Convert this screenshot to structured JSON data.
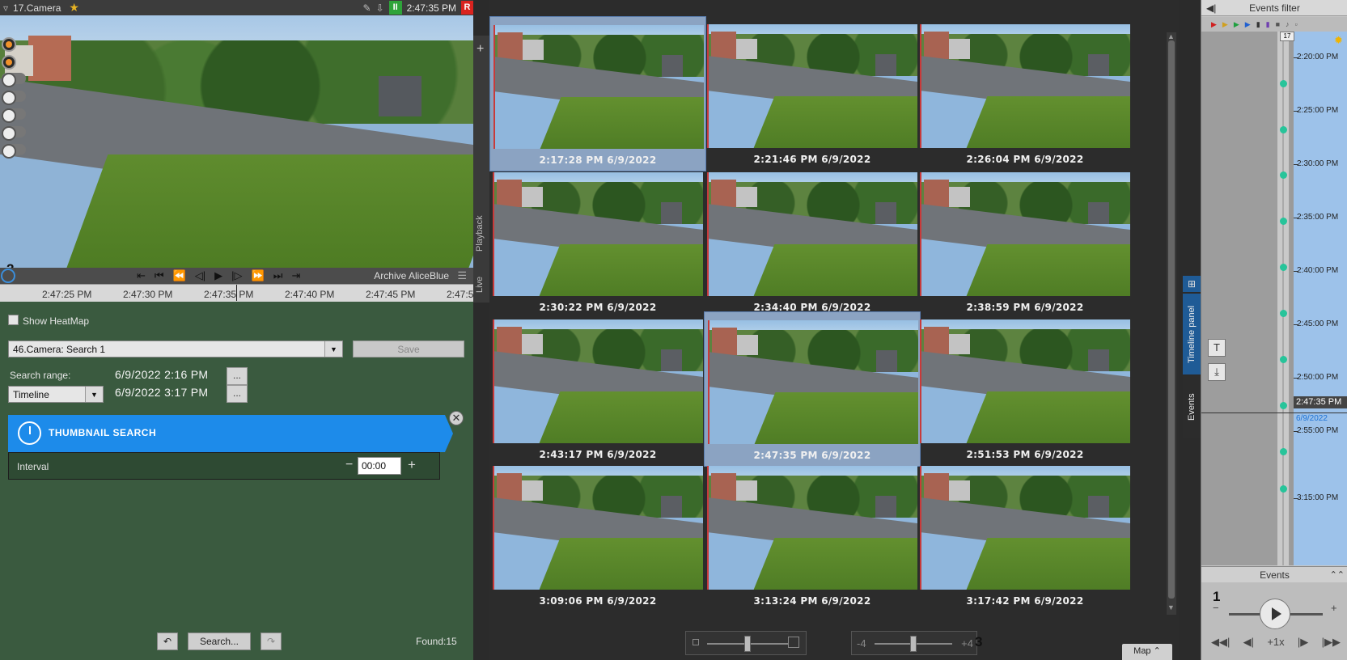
{
  "camera": {
    "title": "17.Camera",
    "time": "2:47:35 PM",
    "pause_glyph": "II",
    "rec_glyph": "R",
    "number_badge": "2",
    "archive_label": "Archive AliceBlue",
    "timescale_ticks": [
      "2:47:25 PM",
      "2:47:30 PM",
      "2:47:35 PM",
      "2:47:40 PM",
      "2:47:45 PM",
      "2:47:5"
    ]
  },
  "side_tabs": {
    "plus": "+",
    "playback": "Playback",
    "live": "Live"
  },
  "search": {
    "heatmap_label": "Show HeatMap",
    "search_name": "46.Camera: Search 1",
    "save_label": "Save",
    "range_label": "Search range:",
    "range_start": "6/9/2022  2:16 PM",
    "range_end": "6/9/2022  3:17 PM",
    "range_mode": "Timeline",
    "dots": "...",
    "thumb_title": "THUMBNAIL SEARCH",
    "interval_label": "Interval",
    "interval_value": "00:00",
    "search_button": "Search...",
    "found": "Found:15"
  },
  "grid": {
    "thumbnails": [
      {
        "caption": "2:17:28 PM 6/9/2022",
        "selected": true
      },
      {
        "caption": "2:21:46 PM 6/9/2022",
        "selected": false
      },
      {
        "caption": "2:26:04 PM 6/9/2022",
        "selected": false
      },
      {
        "caption": "2:30:22 PM 6/9/2022",
        "selected": false
      },
      {
        "caption": "2:34:40 PM 6/9/2022",
        "selected": false
      },
      {
        "caption": "2:38:59 PM 6/9/2022",
        "selected": false
      },
      {
        "caption": "2:43:17 PM 6/9/2022",
        "selected": false
      },
      {
        "caption": "2:47:35 PM 6/9/2022",
        "selected": true
      },
      {
        "caption": "2:51:53 PM 6/9/2022",
        "selected": false
      },
      {
        "caption": "3:09:06 PM 6/9/2022",
        "selected": false
      },
      {
        "caption": "3:13:24 PM 6/9/2022",
        "selected": false
      },
      {
        "caption": "3:17:42 PM 6/9/2022",
        "selected": false
      }
    ],
    "speed_min": "-4",
    "speed_max": "+4",
    "number_badge": "3",
    "map_label": "Map"
  },
  "mid_tabs": {
    "timeline_panel": "Timeline panel",
    "events": "Events"
  },
  "right": {
    "filter_title": "Events filter",
    "day_badge": "17",
    "time_labels": [
      "2:20:00 PM",
      "2:25:00 PM",
      "2:30:00 PM",
      "2:35:00 PM",
      "2:40:00 PM",
      "2:45:00 PM",
      "2:50:00 PM",
      "2:55:00 PM",
      "3:15:00 PM"
    ],
    "cursor_time": "2:47:35 PM",
    "cursor_date": "6/9/2022",
    "events_label": "Events",
    "player_badge": "1",
    "speed": "+1x"
  }
}
